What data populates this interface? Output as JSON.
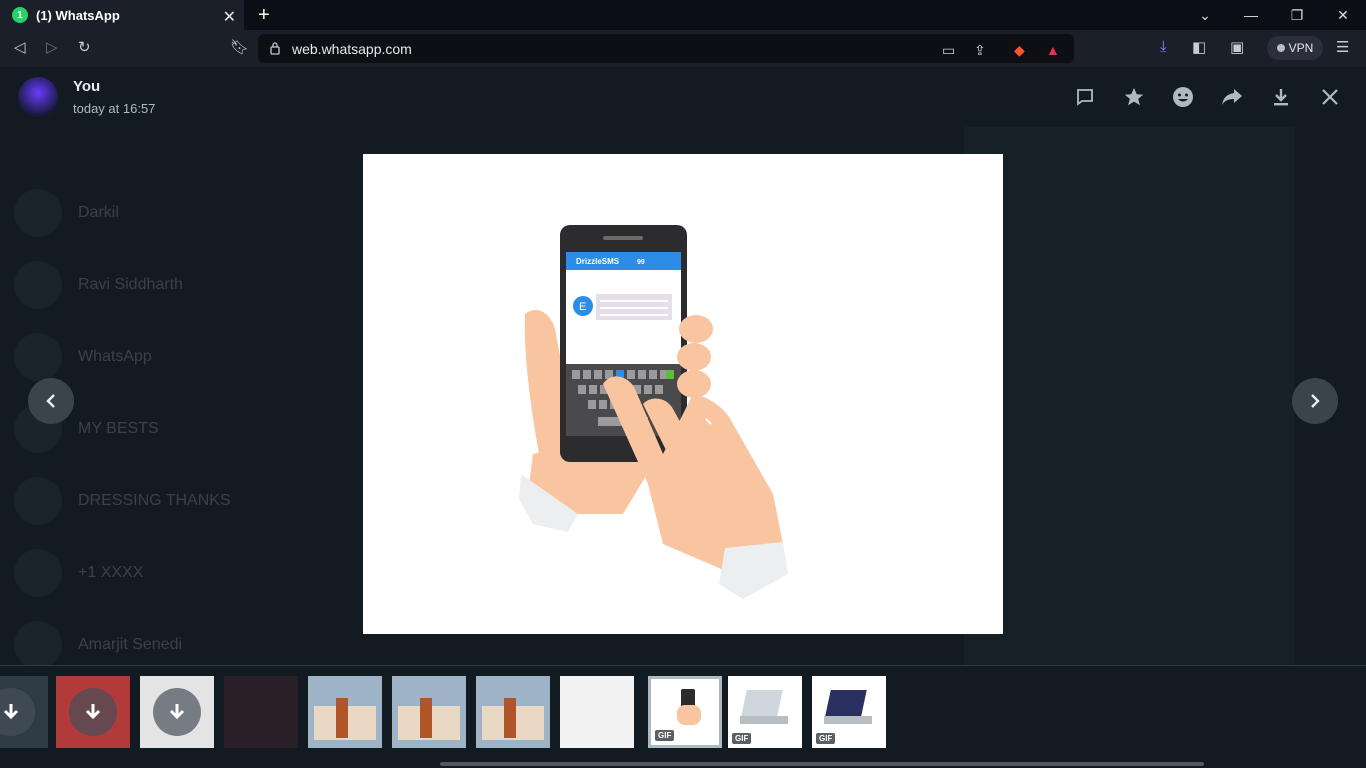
{
  "browser": {
    "tab_title": "(1) WhatsApp",
    "tab_badge": "1",
    "url": "web.whatsapp.com",
    "vpn_label": "VPN"
  },
  "viewer": {
    "sender_name": "You",
    "timestamp": "today at 16:57",
    "actions": [
      "reply-icon",
      "star-icon",
      "emoji-icon",
      "forward-icon",
      "download-icon",
      "close-icon"
    ]
  },
  "media": {
    "app_label": "DrizzleSMS",
    "app_counter": "99",
    "avatar_letter": "E"
  },
  "background_chats": [
    {
      "name": "Darkil"
    },
    {
      "name": "Ravi Siddharth"
    },
    {
      "name": "WhatsApp"
    },
    {
      "name": "MY BESTS"
    },
    {
      "name": "DRESSING THANKS"
    },
    {
      "name": "+1 XXXX"
    },
    {
      "name": "Amarjit Senedi"
    }
  ],
  "thumbnails": [
    {
      "kind": "download"
    },
    {
      "kind": "person-download"
    },
    {
      "kind": "download-light"
    },
    {
      "kind": "dark-ui"
    },
    {
      "kind": "house"
    },
    {
      "kind": "house"
    },
    {
      "kind": "house"
    },
    {
      "kind": "doc"
    },
    {
      "kind": "phone",
      "badge": "GIF",
      "selected": true
    },
    {
      "kind": "laptop",
      "badge": "GIF"
    },
    {
      "kind": "laptop-code",
      "badge": "GIF"
    }
  ]
}
